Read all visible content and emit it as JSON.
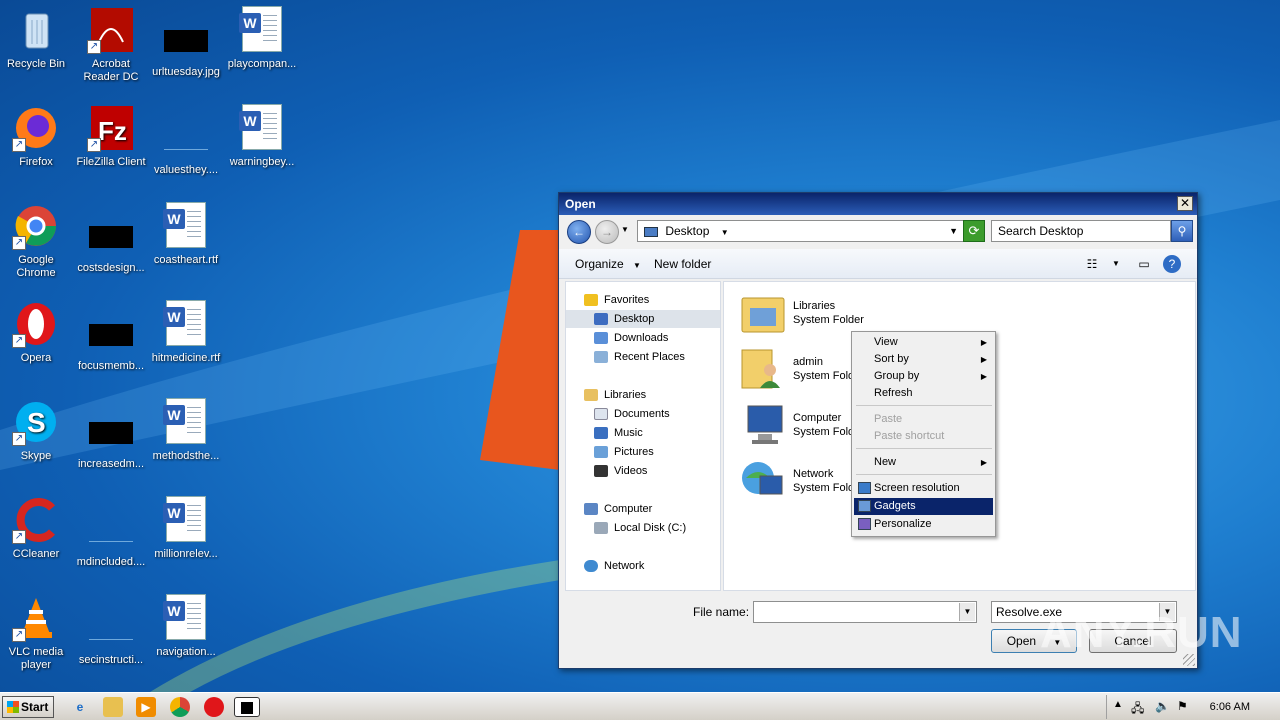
{
  "desktop": {
    "icons": [
      {
        "label": "Recycle Bin"
      },
      {
        "label": "Acrobat Reader DC"
      },
      {
        "label": "urltuesday.jpg"
      },
      {
        "label": "playcompan..."
      },
      {
        "label": "Firefox"
      },
      {
        "label": "FileZilla Client"
      },
      {
        "label": "valuesthey...."
      },
      {
        "label": "warningbey..."
      },
      {
        "label": "Google Chrome"
      },
      {
        "label": "costsdesign..."
      },
      {
        "label": "coastheart.rtf"
      },
      {
        "label": "Opera"
      },
      {
        "label": "focusmemb..."
      },
      {
        "label": "hitmedicine.rtf"
      },
      {
        "label": "Skype"
      },
      {
        "label": "increasedm..."
      },
      {
        "label": "methodsthe..."
      },
      {
        "label": "CCleaner"
      },
      {
        "label": "mdincluded...."
      },
      {
        "label": "millionrelev..."
      },
      {
        "label": "VLC media player"
      },
      {
        "label": "secinstructi..."
      },
      {
        "label": "navigation..."
      }
    ]
  },
  "dialog": {
    "title": "Open",
    "close_glyph": "✕",
    "address": "Desktop",
    "search_placeholder": "Search Desktop",
    "toolbar": {
      "organize": "Organize",
      "new_folder": "New folder"
    },
    "nav": {
      "favorites": "Favorites",
      "desktop": "Desktop",
      "downloads": "Downloads",
      "recent_places": "Recent Places",
      "libraries": "Libraries",
      "documents": "Documents",
      "music": "Music",
      "pictures": "Pictures",
      "videos": "Videos",
      "computer": "Computer",
      "local_disk": "Local Disk (C:)",
      "network": "Network"
    },
    "items": [
      {
        "name": "Libraries",
        "type": "System Folder"
      },
      {
        "name": "admin",
        "type": "System Fold"
      },
      {
        "name": "Computer",
        "type": "System Fold"
      },
      {
        "name": "Network",
        "type": "System Fold"
      }
    ],
    "file_name_label": "File name:",
    "file_name_value": "",
    "filter_value": "Resolve.exe",
    "open_label": "Open",
    "cancel_label": "Cancel"
  },
  "context_menu": {
    "view": "View",
    "sort_by": "Sort by",
    "group_by": "Group by",
    "refresh": "Refresh",
    "paste": "Paste",
    "paste_shortcut": "Paste shortcut",
    "new": "New",
    "screen_resolution": "Screen resolution",
    "gadgets": "Gadgets",
    "personalize": "Personalize"
  },
  "taskbar": {
    "start_label": "Start",
    "clock": "6:06 AM"
  },
  "watermark": "ANY.RUN"
}
